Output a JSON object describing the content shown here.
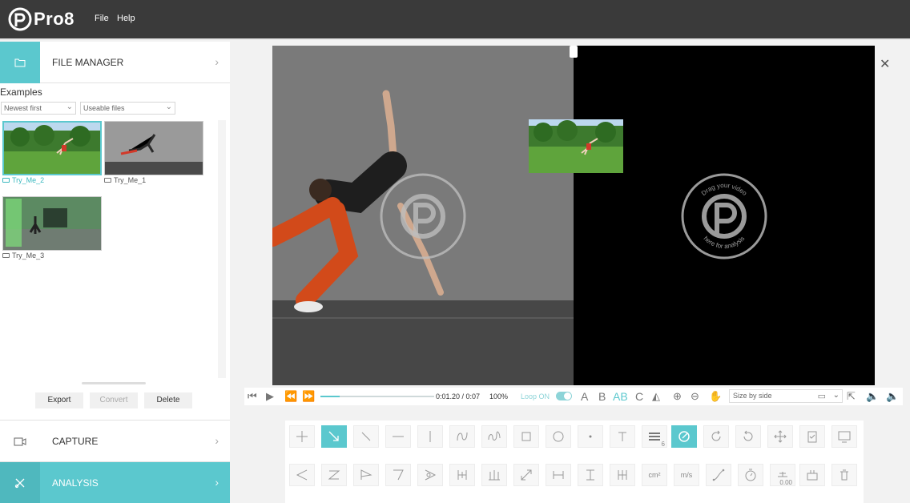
{
  "app": {
    "logo_text": "Pro8"
  },
  "menu": {
    "file": "File",
    "help": "Help"
  },
  "file_manager": {
    "title": "FILE MANAGER",
    "examples_label": "Examples",
    "sort_select": "Newest first",
    "filter_select": "Useable files",
    "files": [
      {
        "name": "Try_Me_2",
        "selected": true
      },
      {
        "name": "Try_Me_1",
        "selected": false
      },
      {
        "name": "Try_Me_3",
        "selected": false
      }
    ],
    "buttons": {
      "export": "Export",
      "convert": "Convert",
      "delete": "Delete"
    }
  },
  "nav": {
    "capture": "CAPTURE",
    "analysis": "ANALYSIS"
  },
  "player": {
    "timecode": "0:01.20 / 0:07",
    "zoom": "100%",
    "loop_label": "Loop ON",
    "progress": 0.17,
    "layout_select": "Size by side",
    "text_tools": {
      "a": "A",
      "b": "B",
      "ab": "AB",
      "c": "C"
    }
  },
  "watermark": {
    "line_top": "Drag your video",
    "line_bottom": "here for analysis"
  },
  "tools": {
    "line_width_value": "6",
    "area_unit": "cm²",
    "speed_unit": "m/s",
    "angle_value": "0.00"
  },
  "colors": {
    "accent": "#5bc8ce",
    "topbar": "#3a3a3a"
  }
}
